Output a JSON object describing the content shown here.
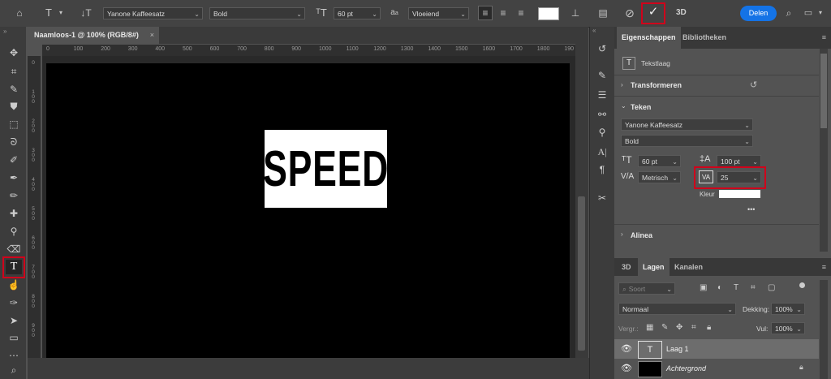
{
  "optionbar": {
    "font_family": "Yanone Kaffeesatz",
    "font_style": "Bold",
    "font_size": "60 pt",
    "antialias_label": "a",
    "antialias_sub": "a",
    "antialias": "Vloeiend",
    "share_label": "Delen",
    "three_d_label": "3D",
    "commit_icon": "checkmark-icon",
    "cancel_icon": "cancel-circle-icon"
  },
  "document": {
    "tab_title": "Naamloos-1 @ 100% (RGB/8#)",
    "close_glyph": "×",
    "canvas_text": "SPEED"
  },
  "rulers": {
    "h_ticks": [
      "0",
      "100",
      "200",
      "300",
      "400",
      "500",
      "600",
      "700",
      "800",
      "900",
      "1000",
      "1100",
      "1200",
      "1300",
      "1400",
      "1500",
      "1600",
      "1700",
      "1800",
      "190"
    ],
    "v_ticks": [
      "0",
      "1 0 0",
      "2 0 0",
      "3 0 0",
      "4 0 0",
      "5 0 0",
      "6 0 0",
      "7 0 0",
      "8 0 0",
      "9 0 0"
    ]
  },
  "properties": {
    "tabs": [
      "Eigenschappen",
      "Bibliotheken"
    ],
    "layer_kind": "Tekstlaag",
    "transform_header": "Transformeren",
    "character_header": "Teken",
    "font_family": "Yanone Kaffeesatz",
    "font_style": "Bold",
    "font_size": "60 pt",
    "leading": "100 pt",
    "kerning": "Metrisch",
    "tracking": "25",
    "color_label": "Kleur",
    "text_color": "#ffffff",
    "more": "•••",
    "paragraph_header": "Alinea"
  },
  "layers": {
    "tabs": [
      "3D",
      "Lagen",
      "Kanalen"
    ],
    "filter_placeholder": "Soort",
    "blend_mode": "Normaal",
    "opacity_label": "Dekking:",
    "opacity": "100%",
    "lock_label": "Vergr.:",
    "fill_label": "Vul:",
    "fill": "100%",
    "items": [
      {
        "name": "Laag 1",
        "type": "text",
        "thumb_glyph": "T"
      },
      {
        "name": "Achtergrond",
        "type": "background"
      }
    ]
  },
  "colors": {
    "highlight": "#d0021b",
    "share_button": "#1473e6",
    "panel_bg": "#535353",
    "dark_bg": "#3c3c3c"
  }
}
